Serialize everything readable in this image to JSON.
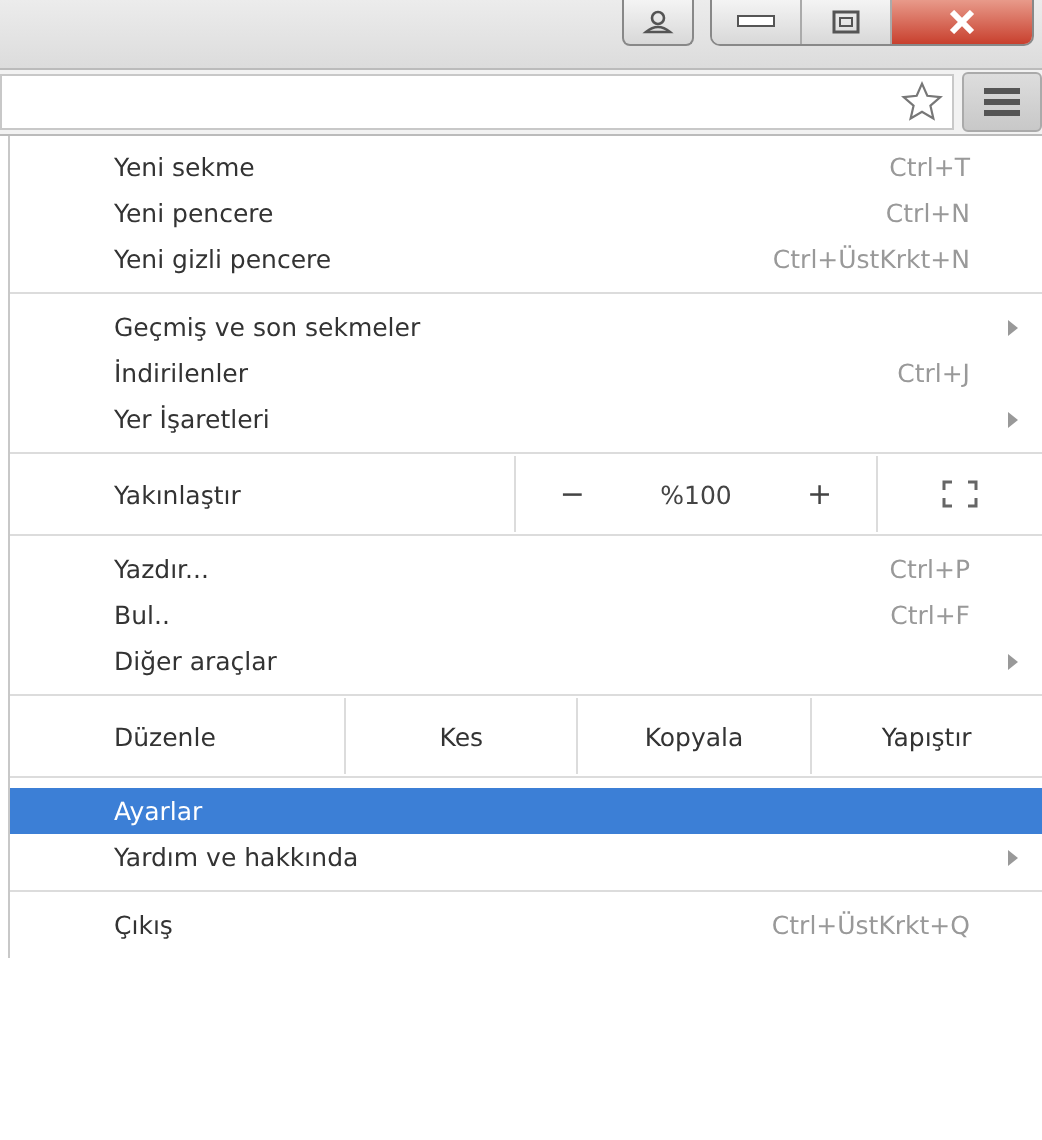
{
  "menu": {
    "sections": [
      {
        "items": [
          {
            "kind": "item",
            "label": "Yeni sekme",
            "shortcut": "Ctrl+T",
            "submenu": false,
            "selected": false
          },
          {
            "kind": "item",
            "label": "Yeni pencere",
            "shortcut": "Ctrl+N",
            "submenu": false,
            "selected": false
          },
          {
            "kind": "item",
            "label": "Yeni gizli pencere",
            "shortcut": "Ctrl+ÜstKrkt+N",
            "submenu": false,
            "selected": false
          }
        ]
      },
      {
        "items": [
          {
            "kind": "item",
            "label": "Geçmiş ve son sekmeler",
            "submenu": true,
            "selected": false
          },
          {
            "kind": "item",
            "label": "İndirilenler",
            "shortcut": "Ctrl+J",
            "submenu": false,
            "selected": false
          },
          {
            "kind": "item",
            "label": "Yer İşaretleri",
            "submenu": true,
            "selected": false
          }
        ]
      },
      {
        "items": [
          {
            "kind": "zoom",
            "label": "Yakınlaştır",
            "minus": "−",
            "value": "%100",
            "plus": "+"
          }
        ]
      },
      {
        "items": [
          {
            "kind": "item",
            "label": "Yazdır...",
            "shortcut": "Ctrl+P",
            "submenu": false,
            "selected": false
          },
          {
            "kind": "item",
            "label": "Bul..",
            "shortcut": "Ctrl+F",
            "submenu": false,
            "selected": false
          },
          {
            "kind": "item",
            "label": "Diğer araçlar",
            "submenu": true,
            "selected": false
          }
        ]
      },
      {
        "items": [
          {
            "kind": "edit",
            "label": "Düzenle",
            "buttons": [
              "Kes",
              "Kopyala",
              "Yapıştır"
            ]
          }
        ]
      },
      {
        "items": [
          {
            "kind": "item",
            "label": "Ayarlar",
            "submenu": false,
            "selected": true
          },
          {
            "kind": "item",
            "label": "Yardım ve hakkında",
            "submenu": true,
            "selected": false
          }
        ]
      },
      {
        "items": [
          {
            "kind": "item",
            "label": "Çıkış",
            "shortcut": "Ctrl+ÜstKrkt+Q",
            "submenu": false,
            "selected": false
          }
        ]
      }
    ]
  }
}
